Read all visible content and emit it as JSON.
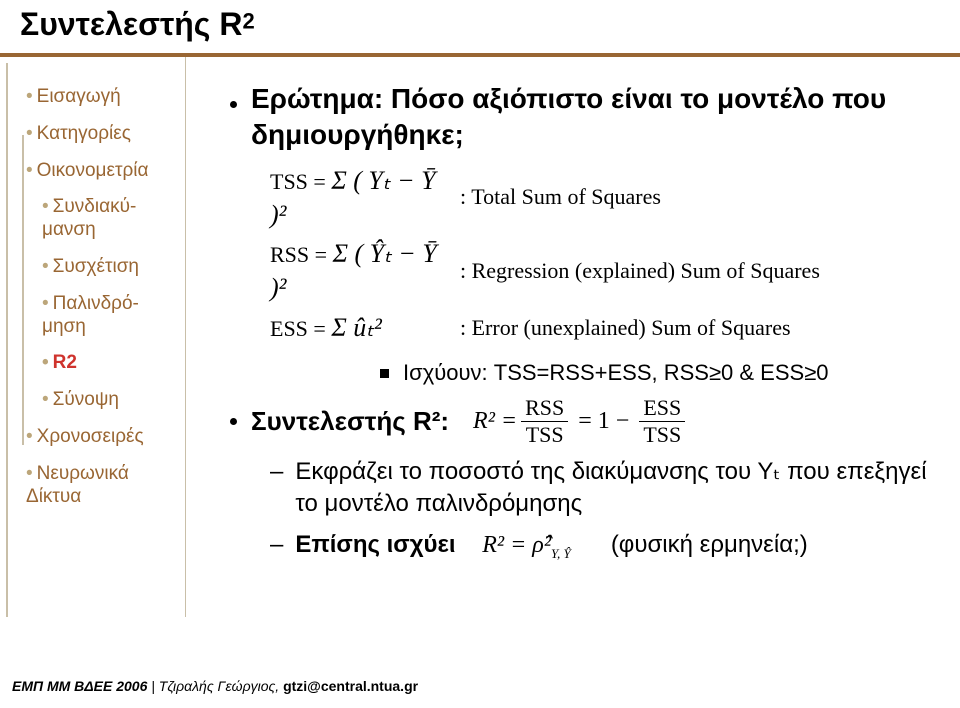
{
  "title": {
    "main": "Συντελεστής R",
    "sup": "2"
  },
  "sidebar": [
    {
      "label": "Εισαγωγή",
      "level": 0,
      "sel": false
    },
    {
      "label": "Κατηγορίες",
      "level": 0,
      "sel": false
    },
    {
      "label": "Οικονομετρία",
      "level": 0,
      "sel": false
    },
    {
      "label": "Συνδιακύ-\nμανση",
      "level": 1,
      "sel": false
    },
    {
      "label": "Συσχέτιση",
      "level": 1,
      "sel": false
    },
    {
      "label": "Παλινδρό-\nμηση",
      "level": 1,
      "sel": false
    },
    {
      "label": "R2",
      "level": 1,
      "sel": true
    },
    {
      "label": "Σύνοψη",
      "level": 1,
      "sel": false
    },
    {
      "label": "Χρονοσειρές",
      "level": 0,
      "sel": false
    },
    {
      "label": "Νευρωνικά Δίκτυα",
      "level": 0,
      "sel": false
    }
  ],
  "content": {
    "question": "Ερώτημα: Πόσο αξιόπιστο είναι το μοντέλο που δημιουργήθηκε;",
    "eq_tss_lhs": "TSS =",
    "eq_tss_sum": "Σ ( Yₜ − Ȳ )²",
    "eq_tss_desc": ": Total Sum of Squares",
    "eq_rss_lhs": "RSS =",
    "eq_rss_sum": "Σ ( Ŷₜ − Ȳ )²",
    "eq_rss_desc": ": Regression (explained) Sum of Squares",
    "eq_ess_lhs": "ESS =",
    "eq_ess_sum": "Σ ûₜ²",
    "eq_ess_desc": ": Error (unexplained) Sum of Squares",
    "identity": "Ισχύουν: TSS=RSS+ESS, RSS≥0 & ESS≥0",
    "coef_label": "Συντελεστής R²:",
    "r2_lhs": "R² =",
    "frac1_num": "RSS",
    "frac1_den": "TSS",
    "eq_mid": "= 1 −",
    "frac2_num": "ESS",
    "frac2_den": "TSS",
    "explain": "Εκφράζει το ποσοστό της διακύμανσης του Υₜ που επεξηγεί το μοντέλο παλινδρόμησης",
    "also_label": "Επίσης ισχύει",
    "also_math": "R² = ρ̂²",
    "also_sub": "Y, Ŷ",
    "also_paren": "(φυσική ερμηνεία;)"
  },
  "footer": {
    "left": "ΕΜΠ ΜΜ ΒΔΕΕ 2006",
    "sep": " | ",
    "author": "Τζιραλής Γεώργιος,",
    "email": " gtzi@central.ntua.gr"
  }
}
